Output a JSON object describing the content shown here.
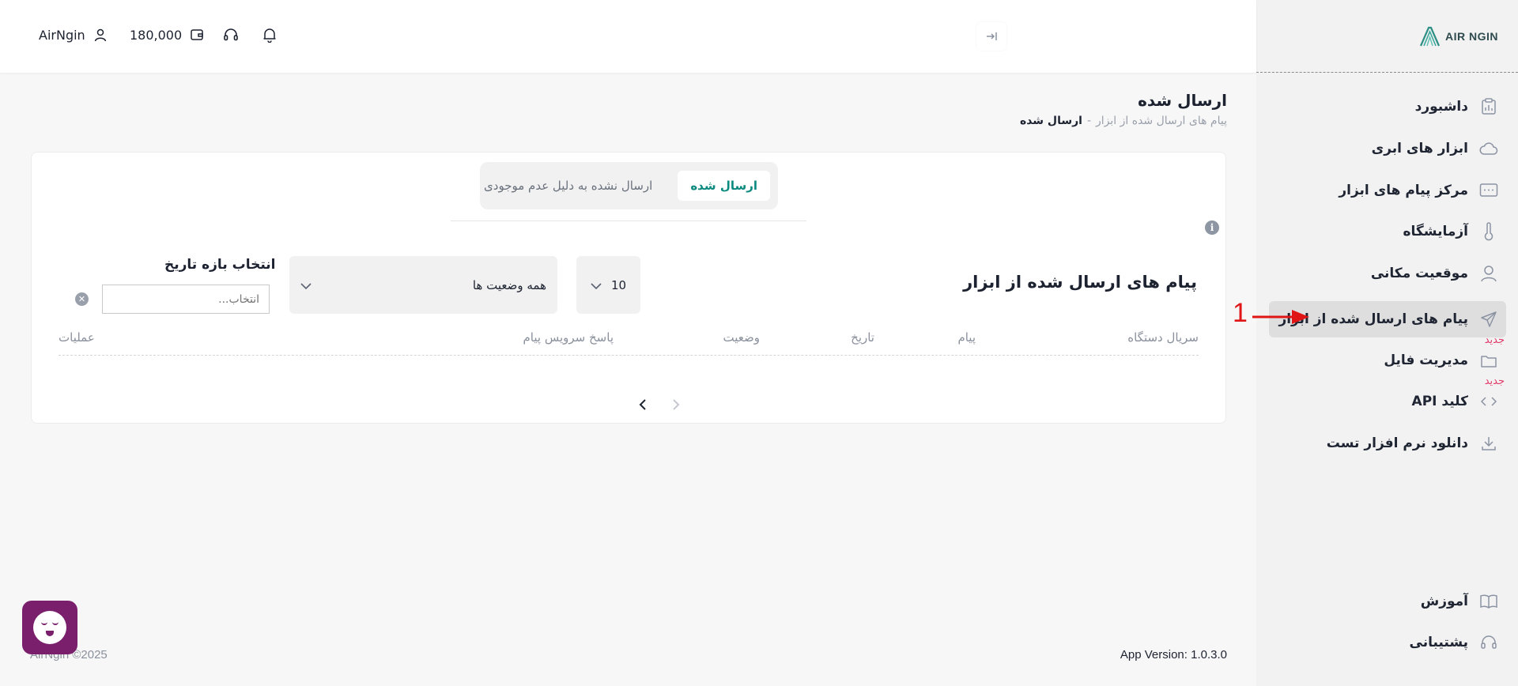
{
  "sidebar": {
    "logo_text": "AIR NGIN",
    "items": [
      {
        "label": "داشبورد",
        "icon": "dashboard-icon",
        "top": 0
      },
      {
        "label": "ابزار های ابری",
        "icon": "cloud-icon"
      },
      {
        "label": "مرکز پیام های ابزار",
        "icon": "message-center-icon"
      },
      {
        "label": "آزمایشگاه",
        "icon": "thermometer-icon"
      },
      {
        "label": "موقعیت مکانی",
        "icon": "location-person-icon"
      },
      {
        "label": "پیام های ارسال شده از ابزار",
        "icon": "send-icon"
      },
      {
        "label": "مدیریت فایل",
        "icon": "folder-icon",
        "badge": "جدید"
      },
      {
        "label": "کلید API",
        "icon": "code-icon",
        "badge": "جدید"
      },
      {
        "label": "دانلود نرم افزار تست",
        "icon": "download-icon"
      }
    ],
    "bottom_items": [
      {
        "label": "آموزش",
        "icon": "book-icon"
      },
      {
        "label": "پشتیبانی",
        "icon": "headset-icon"
      }
    ]
  },
  "header": {
    "username": "AirNgin",
    "balance": "180,000"
  },
  "page": {
    "title": "ارسال شده",
    "breadcrumb_parent": "پیام های ارسال شده از ابزار",
    "breadcrumb_separator": "-",
    "breadcrumb_current": "ارسال شده"
  },
  "tabs": {
    "sent": "ارسال شده",
    "not_sent": "ارسال نشده به دلیل عدم موجودی"
  },
  "section": {
    "title": "پیام های ارسال شده از ابزار",
    "page_size": "10",
    "status_filter": "همه وضعیت ها",
    "date_label": "انتخاب بازه تاریخ",
    "date_placeholder": "انتخاب..."
  },
  "table": {
    "columns": {
      "serial": "سریال دستگاه",
      "message": "پیام",
      "date": "تاریخ",
      "status": "وضعیت",
      "service_response": "پاسخ سرویس پیام",
      "actions": "عملیات"
    }
  },
  "footer": {
    "version": "App Version: 1.0.3.0",
    "copyright": "AirNgin ©2025"
  },
  "annotation": {
    "number": "1"
  },
  "colors": {
    "accent": "#0d8a80",
    "badge": "#e23b6a",
    "chat_widget": "#7a1f6c",
    "annotation": "#e01515"
  }
}
